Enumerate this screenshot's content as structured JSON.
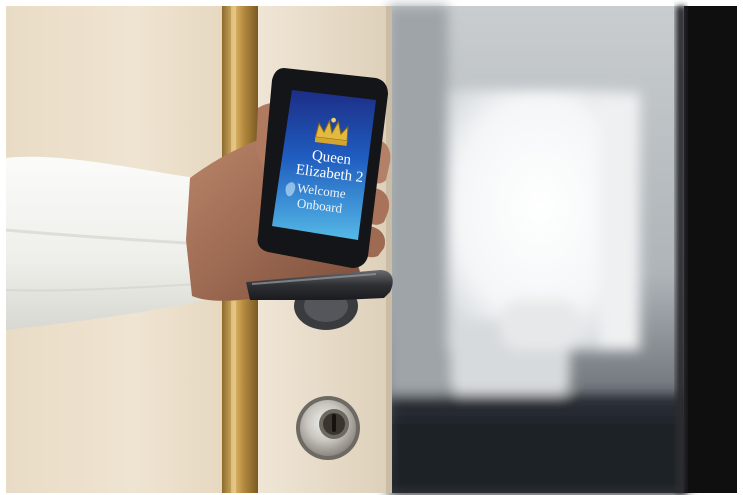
{
  "phone_screen": {
    "brand_line1": "Queen",
    "brand_line2": "Elizabeth 2",
    "greeting_line1": "Welcome",
    "greeting_line2": "Onboard"
  }
}
